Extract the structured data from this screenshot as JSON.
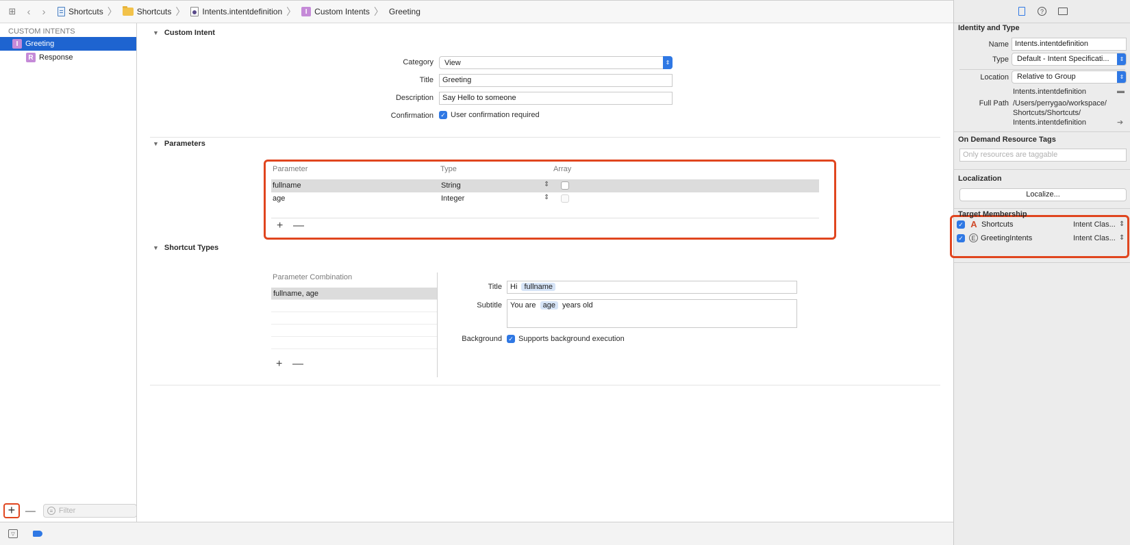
{
  "breadcrumbs": [
    {
      "label": "Shortcuts",
      "icon": "project-file-icon"
    },
    {
      "label": "Shortcuts",
      "icon": "folder-icon"
    },
    {
      "label": "Intents.intentdefinition",
      "icon": "intent-definition-file-icon"
    },
    {
      "label": "Custom Intents",
      "icon": "intent-badge-icon"
    },
    {
      "label": "Greeting",
      "icon": ""
    }
  ],
  "navigator": {
    "section_title": "CUSTOM INTENTS",
    "items": [
      {
        "badge": "I",
        "label": "Greeting"
      },
      {
        "badge": "R",
        "label": "Response"
      }
    ],
    "add_label": "+",
    "remove_label": "—",
    "filter_placeholder": "Filter"
  },
  "custom_intent": {
    "title": "Custom Intent",
    "category_label": "Category",
    "category_value": "View",
    "title_label": "Title",
    "title_value": "Greeting",
    "description_label": "Description",
    "description_value": "Say Hello to someone",
    "confirmation_label": "Confirmation",
    "confirmation_text": "User confirmation required"
  },
  "parameters": {
    "title": "Parameters",
    "headers": [
      "Parameter",
      "Type",
      "Array"
    ],
    "rows": [
      {
        "name": "fullname",
        "type": "String"
      },
      {
        "name": "age",
        "type": "Integer"
      }
    ],
    "add_label": "+",
    "remove_label": "—"
  },
  "shortcut_types": {
    "title": "Shortcut Types",
    "combo_header": "Parameter Combination",
    "combos": [
      "fullname, age"
    ],
    "title_label": "Title",
    "title_prefix": "Hi",
    "title_token": "fullname",
    "subtitle_label": "Subtitle",
    "subtitle_prefix": "You are",
    "subtitle_token": "age",
    "subtitle_suffix": "years old",
    "background_label": "Background",
    "background_text": "Supports background execution",
    "add_label": "+",
    "remove_label": "—"
  },
  "inspector": {
    "identity_title": "Identity and Type",
    "name_label": "Name",
    "name_value": "Intents.intentdefinition",
    "type_label": "Type",
    "type_value": "Default - Intent Specificati...",
    "location_label": "Location",
    "location_value": "Relative to Group",
    "location_file": "Intents.intentdefinition",
    "fullpath_label": "Full Path",
    "fullpath_lines": [
      "/Users/perrygao/workspace/",
      "Shortcuts/Shortcuts/",
      "Intents.intentdefinition"
    ],
    "odr_title": "On Demand Resource Tags",
    "odr_placeholder": "Only resources are taggable",
    "localization_title": "Localization",
    "localize_button": "Localize...",
    "target_title": "Target Membership",
    "targets": [
      {
        "name": "Shortcuts",
        "icon": "app-target-icon",
        "value": "Intent Clas..."
      },
      {
        "name": "GreetingIntents",
        "icon": "extension-target-icon",
        "value": "Intent Clas..."
      }
    ]
  },
  "colors": {
    "selection": "#1e64d0",
    "accent": "#2f78e4",
    "highlight_box": "#e0451e",
    "badge": "#c58ad8"
  }
}
